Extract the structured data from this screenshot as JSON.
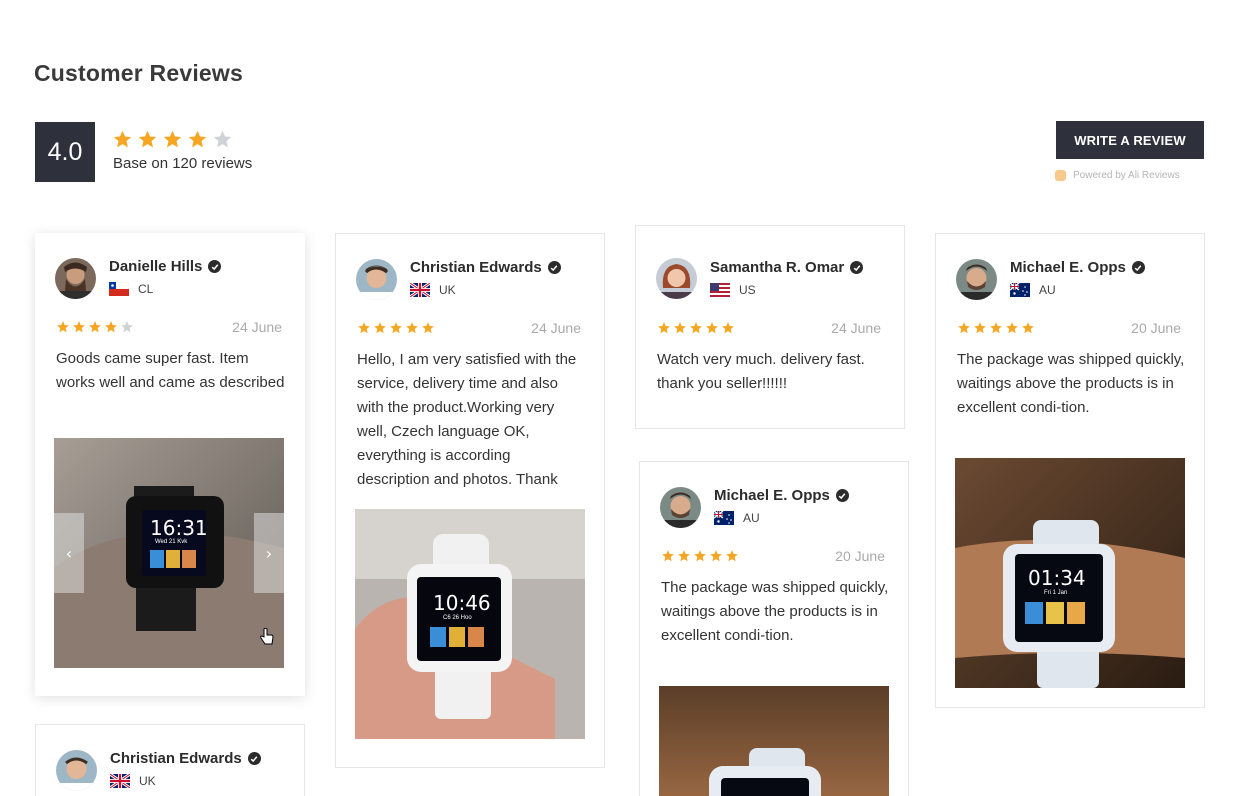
{
  "page": {
    "title": "Customer Reviews",
    "rating_value": "4.0",
    "rating_stars": 4,
    "rating_caption": "Base on 120 reviews",
    "write_review_label": "WRITE A REVIEW",
    "powered_by": "Powered by Ali Reviews"
  },
  "colors": {
    "star": "#f5a623",
    "star_empty": "#cfd3d8",
    "dark": "#2e313b"
  },
  "reviews": [
    {
      "name": "Danielle Hills",
      "country": "CL",
      "flag": "chile-flag",
      "rating": 4,
      "date": "24 June",
      "text": "Goods came super fast. Item works well and came as described",
      "watch_time": "16:31",
      "watch_date": "Wed 21 Kvk"
    },
    {
      "name": "Christian Edwards",
      "country": "UK",
      "flag": "uk-flag",
      "rating": 5,
      "date": "24 June",
      "text": "Hello, I am very satisfied with the service, delivery time and also with the product.Working very well, Czech language OK, everything is according description and photos. Thank",
      "watch_time": "10:46",
      "watch_date": "C6 26 Hoo"
    },
    {
      "name": "Samantha R. Omar",
      "country": "US",
      "flag": "us-flag",
      "rating": 5,
      "date": "24 June",
      "text": "Watch very much. delivery fast. thank you seller!!!!!!"
    },
    {
      "name": "Michael E. Opps",
      "country": "AU",
      "flag": "australia-flag",
      "rating": 5,
      "date": "20 June",
      "text": "The package was shipped quickly, waitings above the products is in excellent condi-tion.",
      "watch_time": "01:34",
      "watch_date": "Fri 1 Jan"
    },
    {
      "name": "Michael E. Opps",
      "country": "AU",
      "flag": "australia-flag",
      "rating": 5,
      "date": "20 June",
      "text": "The package was shipped quickly, waitings above the products is in excellent condi-tion."
    },
    {
      "name": "Christian Edwards",
      "country": "UK",
      "flag": "uk-flag"
    }
  ]
}
